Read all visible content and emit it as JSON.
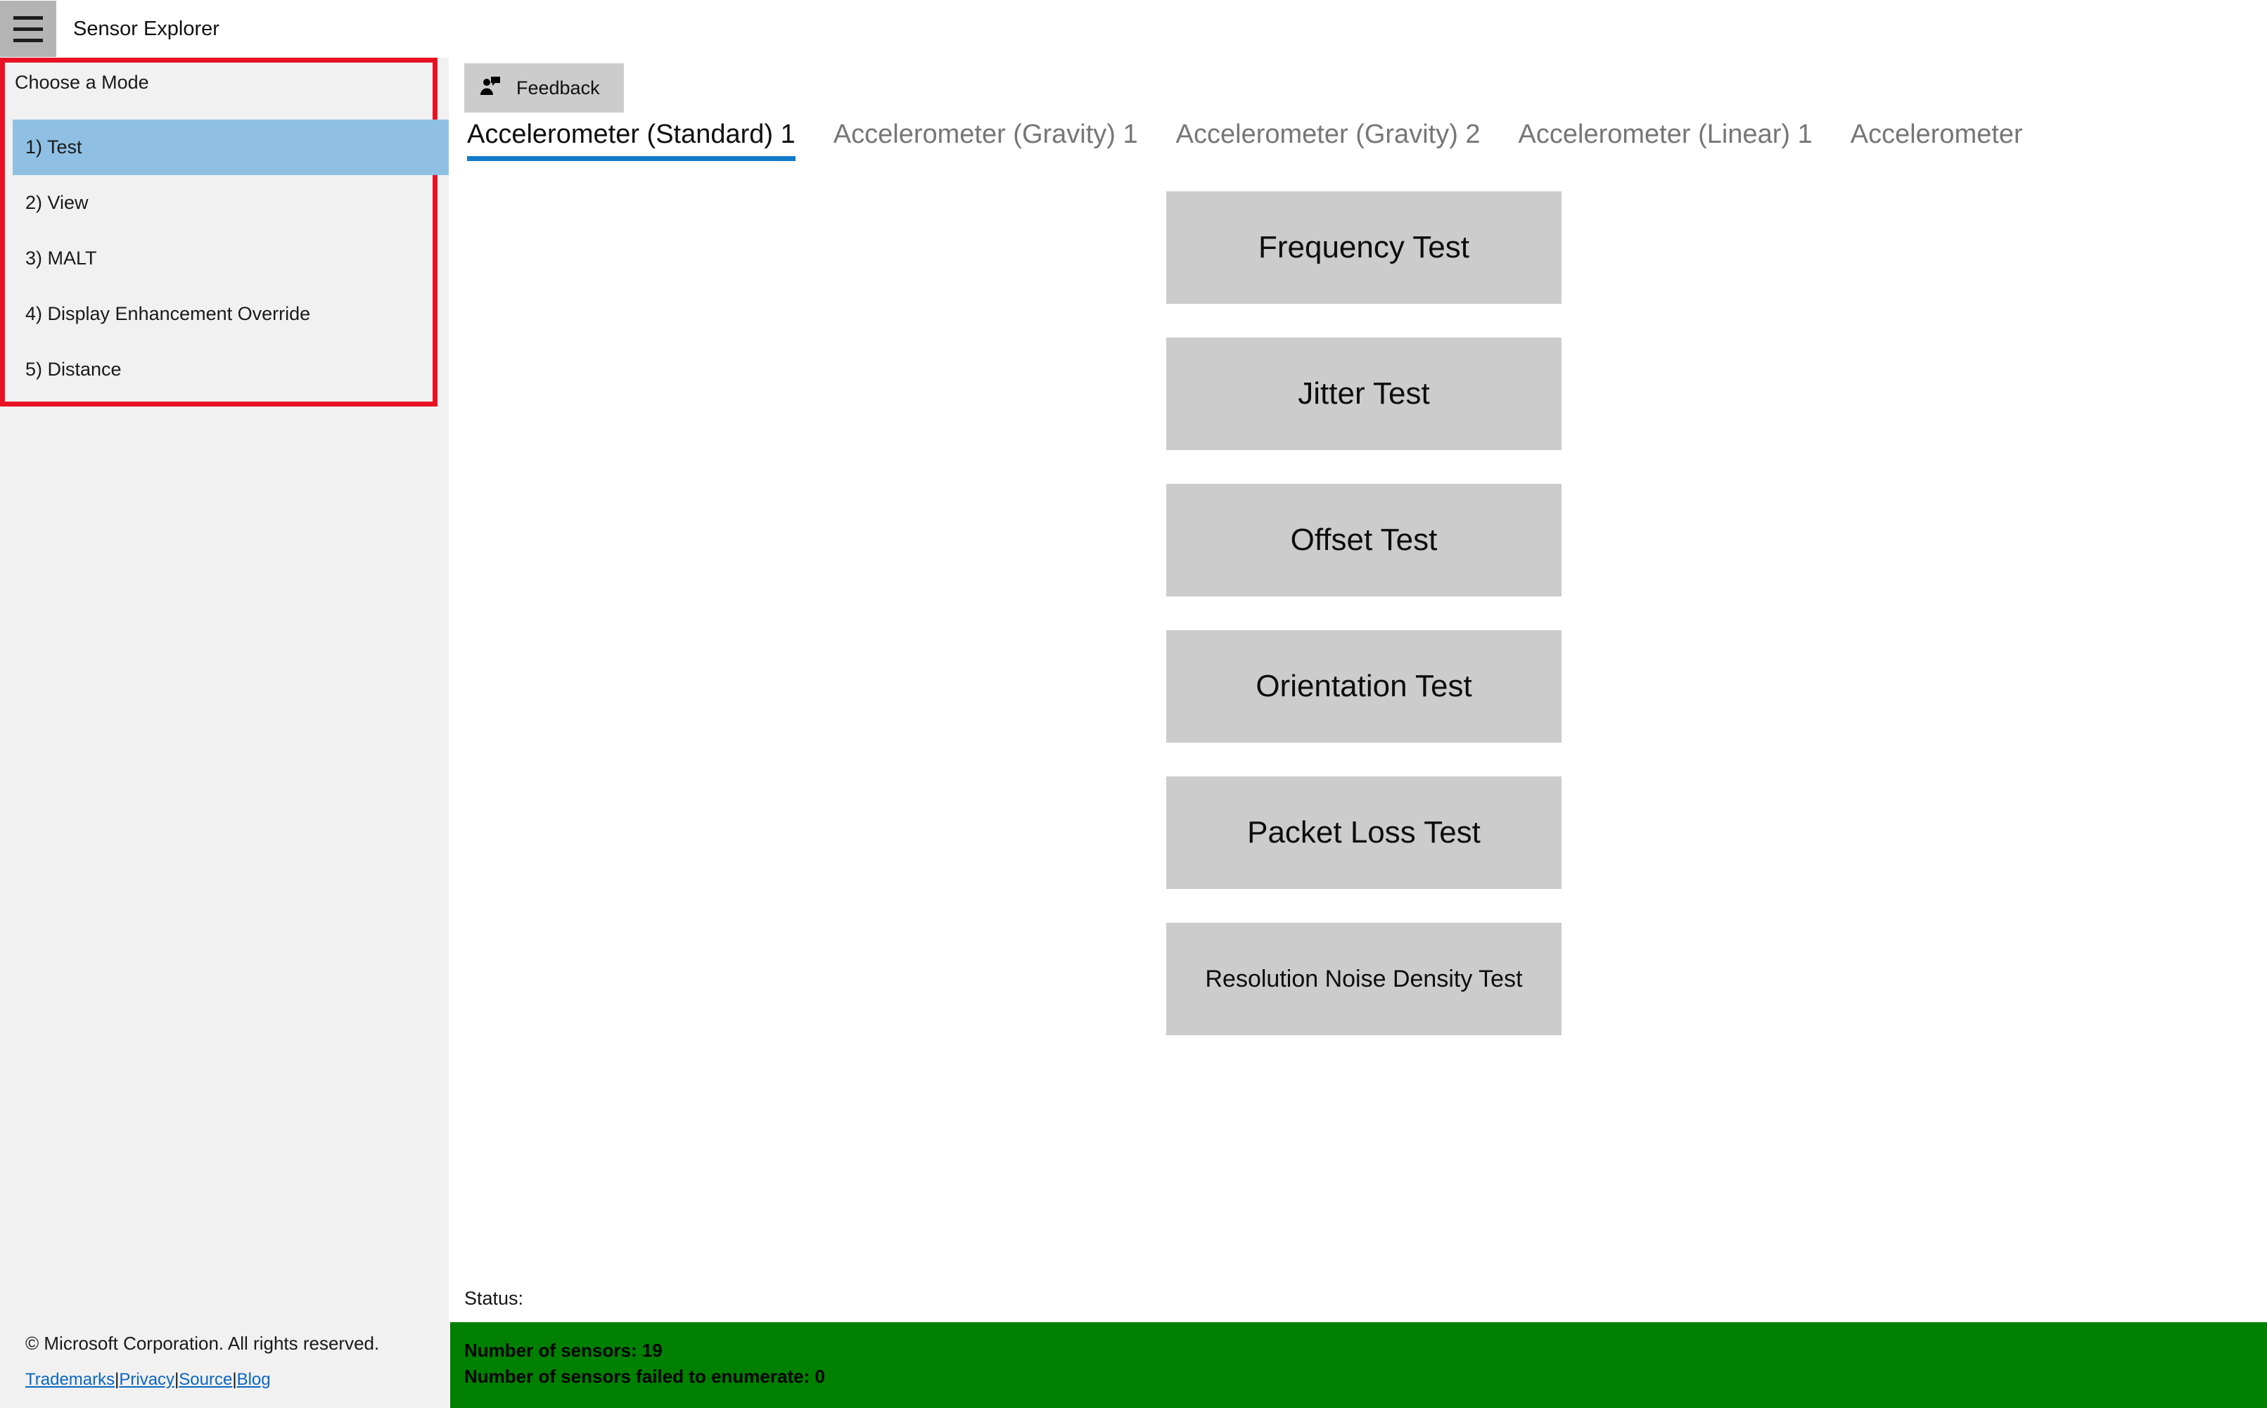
{
  "titlebar": {
    "menu_icon": "hamburger-icon",
    "app_title": "Sensor Explorer"
  },
  "sidebar": {
    "mode_heading": "Choose a Mode",
    "highlight_box_color": "#e81123",
    "selected_color": "#8fc0e4",
    "modes": [
      {
        "label": "1) Test",
        "selected": true
      },
      {
        "label": "2) View",
        "selected": false
      },
      {
        "label": "3) MALT",
        "selected": false
      },
      {
        "label": "4) Display Enhancement Override",
        "selected": false
      },
      {
        "label": "5) Distance",
        "selected": false
      }
    ],
    "footer": {
      "copyright": "© Microsoft Corporation. All rights reserved.",
      "links": [
        "Trademarks",
        "Privacy",
        "Source",
        "Blog"
      ],
      "separator": "|",
      "link_color": "#0a66c2"
    }
  },
  "content": {
    "feedback_button": {
      "label": "Feedback",
      "icon": "person-feedback-icon"
    },
    "tabs": [
      {
        "label": "Accelerometer (Standard) 1",
        "active": true
      },
      {
        "label": "Accelerometer (Gravity) 1",
        "active": false
      },
      {
        "label": "Accelerometer (Gravity) 2",
        "active": false
      },
      {
        "label": "Accelerometer (Linear) 1",
        "active": false
      },
      {
        "label": "Accelerometer",
        "active": false
      }
    ],
    "active_tab_underline_color": "#1479c9",
    "test_buttons": [
      {
        "label": "Frequency Test",
        "small": false
      },
      {
        "label": "Jitter Test",
        "small": false
      },
      {
        "label": "Offset Test",
        "small": false
      },
      {
        "label": "Orientation Test",
        "small": false
      },
      {
        "label": "Packet Loss Test",
        "small": false
      },
      {
        "label": "Resolution Noise Density Test",
        "small": true
      }
    ],
    "status": {
      "label": "Status:",
      "banner_color": "#008000",
      "lines": [
        "Number of sensors: 19",
        "Number of sensors failed to enumerate: 0"
      ]
    }
  }
}
